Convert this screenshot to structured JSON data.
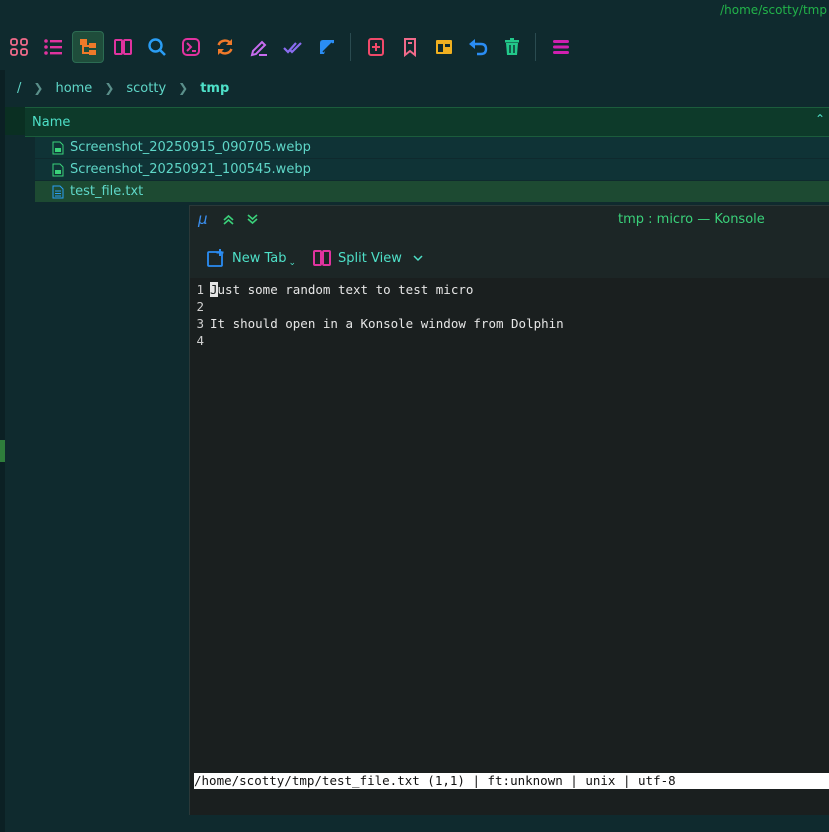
{
  "window": {
    "path_title": "/home/scotty/tmp"
  },
  "toolbar": {
    "icons": [
      "grid-icon",
      "list-icon",
      "tree-view-icon",
      "split-pane-icon",
      "search-icon",
      "terminal-icon",
      "refresh-icon",
      "rename-icon",
      "select-all-icon",
      "edit-icon",
      "new-bookmark-icon",
      "bookmark-icon",
      "panel-icon",
      "undo-icon",
      "trash-icon",
      "menu-icon"
    ]
  },
  "breadcrumb": {
    "root": "/",
    "items": [
      "home",
      "scotty"
    ],
    "current": "tmp"
  },
  "file_list": {
    "column_header": "Name",
    "sort_indicator": "^",
    "files": [
      {
        "name": "Screenshot_20250915_090705.webp",
        "type": "image"
      },
      {
        "name": "Screenshot_20250921_100545.webp",
        "type": "image"
      },
      {
        "name": "test_file.txt",
        "type": "text"
      }
    ]
  },
  "konsole": {
    "title": "tmp : micro — Konsole",
    "titlebar_icons": [
      "micro-app-icon",
      "keep-above-icon",
      "keep-below-icon"
    ],
    "toolbar": {
      "new_tab": "New Tab",
      "split_view": "Split View"
    },
    "editor": {
      "lines": [
        {
          "num": "1",
          "cursor_char": "J",
          "text": "ust some random text to test micro"
        },
        {
          "num": "2",
          "cursor_char": "",
          "text": ""
        },
        {
          "num": "3",
          "cursor_char": "",
          "text": "It should open in a Konsole window from Dolphin"
        },
        {
          "num": "4",
          "cursor_char": "",
          "text": ""
        }
      ],
      "status_line": "/home/scotty/tmp/test_file.txt (1,1) | ft:unknown | unix | utf-8"
    }
  },
  "colors": {
    "accent_green": "#22b34a",
    "text_teal": "#5fd7c8",
    "icon_pink": "#e0339f"
  }
}
